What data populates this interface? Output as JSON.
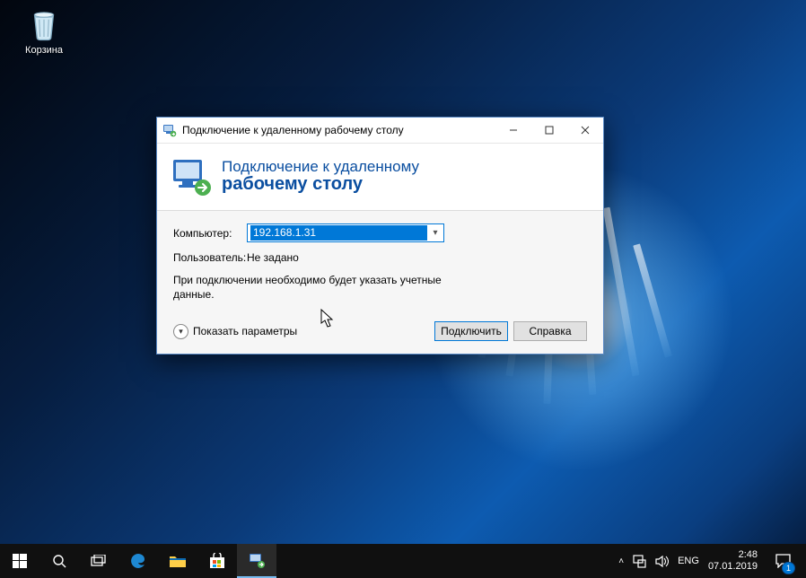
{
  "desktop_icon": {
    "label": "Корзина"
  },
  "dialog": {
    "title": "Подключение к удаленному рабочему столу",
    "header_line1": "Подключение к удаленному",
    "header_line2": "рабочему столу",
    "computer_label": "Компьютер:",
    "computer_value": "192.168.1.31",
    "user_label": "Пользователь:",
    "user_value": "Не задано",
    "hint": "При подключении необходимо будет указать учетные данные.",
    "show_options": "Показать параметры",
    "connect": "Подключить",
    "help": "Справка"
  },
  "taskbar": {
    "lang": "ENG",
    "time": "2:48",
    "date": "07.01.2019",
    "notif_count": "1"
  }
}
